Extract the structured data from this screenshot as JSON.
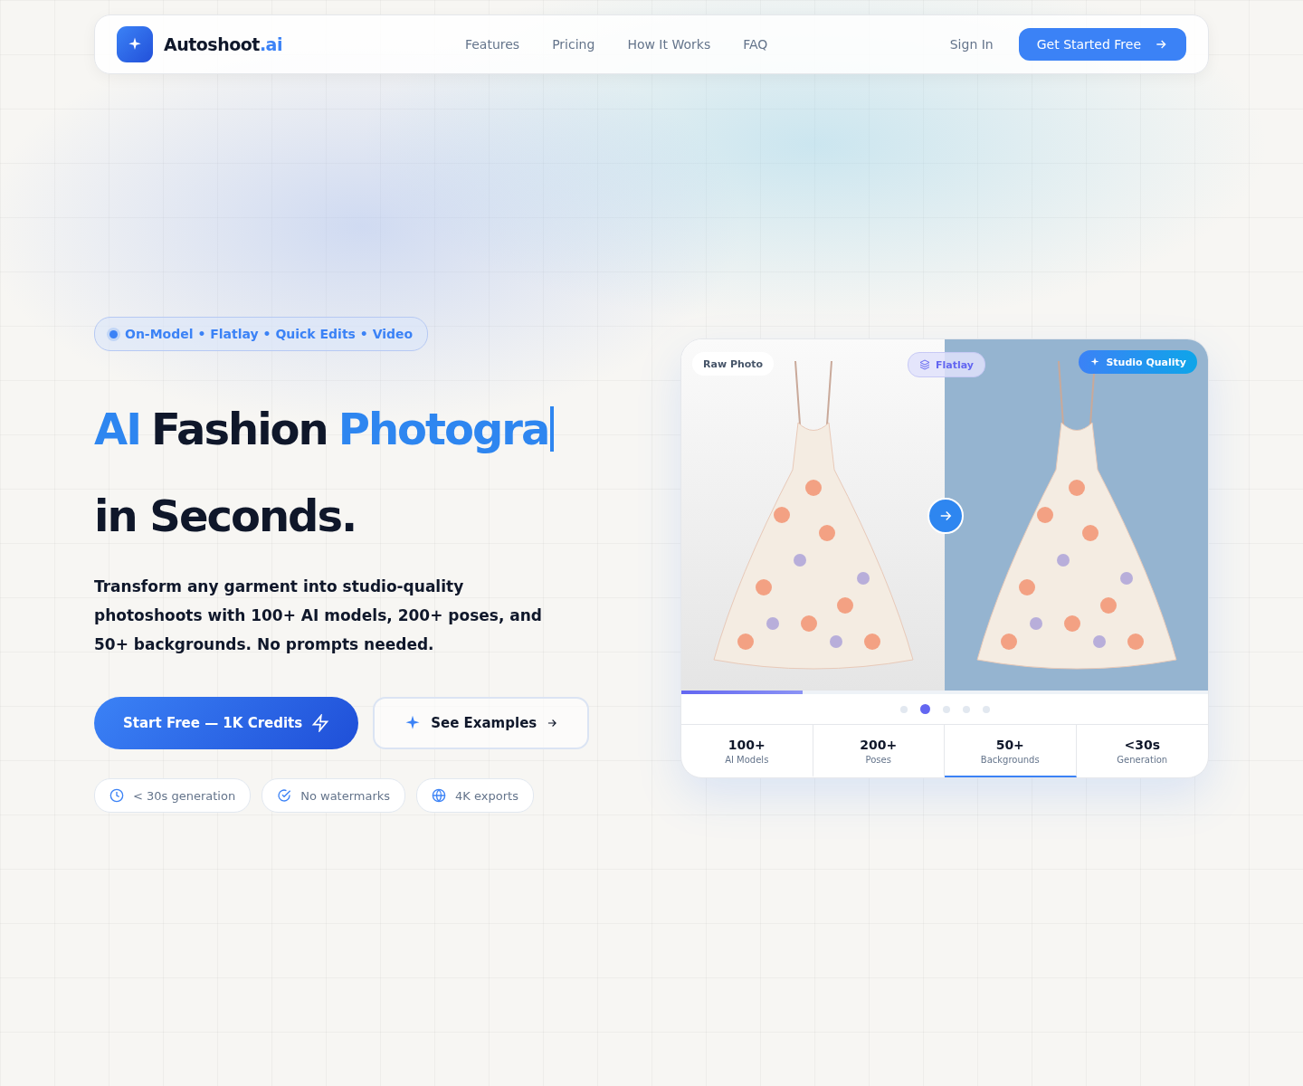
{
  "nav": {
    "brand": {
      "name": "Autoshoot",
      "suffix": ".ai"
    },
    "links": [
      {
        "label": "Features"
      },
      {
        "label": "Pricing"
      },
      {
        "label": "How It Works"
      },
      {
        "label": "FAQ"
      }
    ],
    "sign_in": "Sign In",
    "cta": "Get Started Free"
  },
  "hero": {
    "badge": "On-Model • Flatlay • Quick Edits • Video",
    "headline": [
      {
        "text": "AI",
        "accent": true
      },
      {
        "text": "Fashion",
        "accent": false
      },
      {
        "text": "Photogra",
        "accent": true
      }
    ],
    "headline_line2": "in Seconds.",
    "description": "Transform any garment into studio-quality photoshoots with 100+ AI models, 200+ poses, and 50+ backgrounds. No prompts needed.",
    "primary_button": "Start Free — 1K Credits",
    "secondary_button": "See Examples",
    "features": [
      {
        "kind": "clock",
        "label": "< 30s generation"
      },
      {
        "kind": "check",
        "label": "No watermarks"
      },
      {
        "kind": "globe",
        "label": "4K exports"
      }
    ]
  },
  "preview": {
    "before_label": "Raw Photo",
    "mode_label": "Flatlay",
    "after_label": "Studio Quality",
    "progress": {
      "level": 0.23
    },
    "dots": [
      {
        "selected": false
      },
      {
        "selected": true
      },
      {
        "selected": false
      },
      {
        "selected": false
      },
      {
        "selected": false
      }
    ],
    "stats": [
      {
        "value": "100+",
        "label": "AI Models",
        "selected": false
      },
      {
        "value": "200+",
        "label": "Poses",
        "selected": false
      },
      {
        "value": "50+",
        "label": "Backgrounds",
        "selected": true
      },
      {
        "value": "<30s",
        "label": "Generation",
        "selected": false
      }
    ]
  }
}
